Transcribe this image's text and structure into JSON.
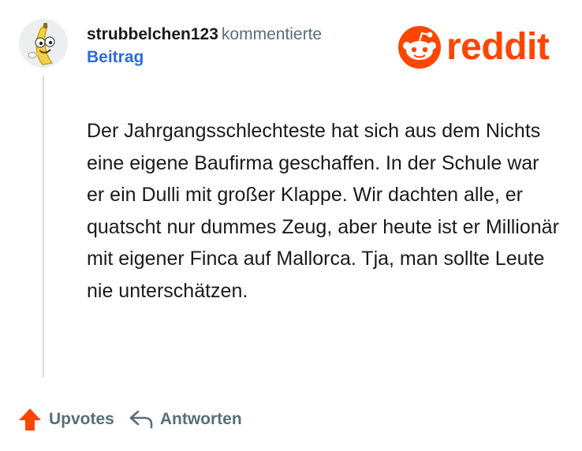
{
  "comment": {
    "username": "strubbelchen123",
    "action": "kommentierte",
    "post_link": "Beitrag",
    "body": "Der Jahrgangsschlechteste hat sich aus dem Nichts eine eigene Baufirma geschaffen. In der Schule war er ein Dulli mit großer Klappe. Wir dachten alle, er quatscht nur dummes Zeug, aber heute ist er Millionär mit eigener Finca auf Mallorca. Tja, man sollte Leute nie unterschätzen."
  },
  "logo": {
    "text": "reddit",
    "icon": "reddit-snoo-icon"
  },
  "avatar": {
    "icon": "banana-character-icon"
  },
  "footer": {
    "upvote_label": "Upvotes",
    "upvote_icon": "upvote-arrow-icon",
    "reply_label": "Antworten",
    "reply_icon": "reply-arrow-icon"
  },
  "colors": {
    "brand": "#ff4500",
    "link": "#2b6cd8",
    "muted": "#576f76"
  }
}
